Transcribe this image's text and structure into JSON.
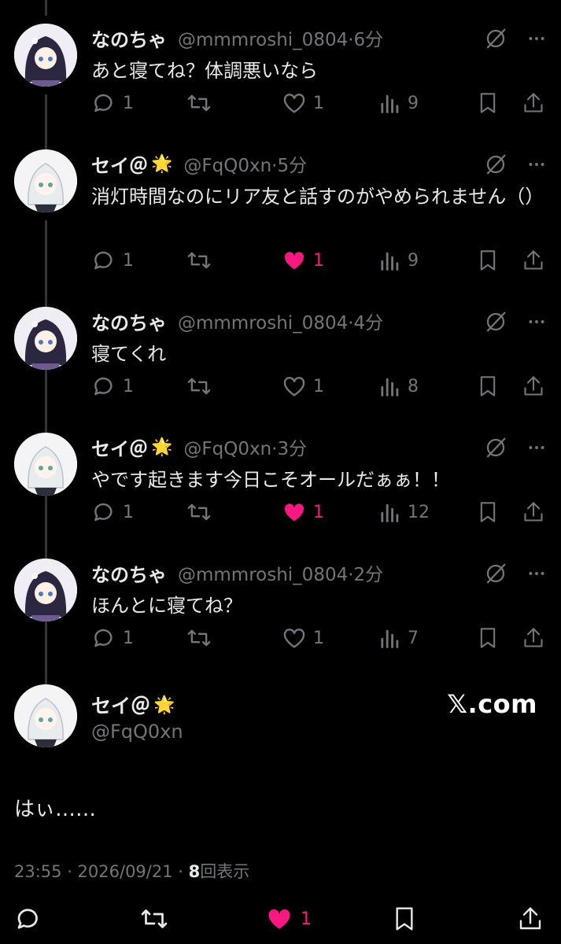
{
  "icons": {
    "reply": "reply-icon",
    "retweet": "retweet-icon",
    "like": "heart-icon",
    "views": "views-bar-icon",
    "bookmark": "bookmark-icon",
    "share": "share-icon",
    "grok": "grok-icon",
    "more": "more-dots-icon"
  },
  "colors": {
    "background": "#000000",
    "text": "#e7e9ea",
    "muted": "#71767b",
    "like": "#f91880",
    "thread": "#333639"
  },
  "tweets": [
    {
      "name": "なのちゃ",
      "badge": "",
      "handle": "@mmmroshi_0804·6分",
      "text": "あと寝てね？体調悪いなら",
      "replies": "1",
      "retweets": "",
      "likes": "1",
      "liked": false,
      "views": "9"
    },
    {
      "name": "セイ＠",
      "badge": "🌟",
      "handle": "@FqQ0xn·5分",
      "text": "消灯時間なのにリア友と話すのがやめられません（）",
      "replies": "1",
      "retweets": "",
      "likes": "1",
      "liked": true,
      "views": "9"
    },
    {
      "name": "なのちゃ",
      "badge": "",
      "handle": "@mmmroshi_0804·4分",
      "text": "寝てくれ",
      "replies": "1",
      "retweets": "",
      "likes": "1",
      "liked": false,
      "views": "8"
    },
    {
      "name": "セイ＠",
      "badge": "🌟",
      "handle": "@FqQ0xn·3分",
      "text": "やです起きます今日こそオールだぁぁ！！",
      "replies": "1",
      "retweets": "",
      "likes": "1",
      "liked": true,
      "views": "12"
    },
    {
      "name": "なのちゃ",
      "badge": "",
      "handle": "@mmmroshi_0804·2分",
      "text": "ほんとに寝てね？",
      "replies": "1",
      "retweets": "",
      "likes": "1",
      "liked": false,
      "views": "7"
    }
  ],
  "main": {
    "name": "セイ＠",
    "badge": "🌟",
    "handle": "@FqQ0xn",
    "watermark": "𝕏.com",
    "text": "はぃ……",
    "time": "23:55 · 2026/09/21 · ",
    "views_count": "8",
    "views_label": "回表示",
    "likes": "1"
  }
}
